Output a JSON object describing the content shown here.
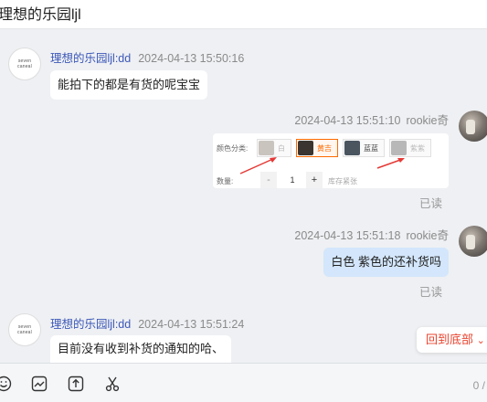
{
  "header": {
    "title": "理想的乐园ljl"
  },
  "messages": [
    {
      "name": "理想的乐园ljl:dd",
      "time": "2024-04-13 15:50:16",
      "text": "能拍下的都是有货的呢宝宝"
    },
    {
      "time": "2024-04-13 15:51:10",
      "name": "rookie奇",
      "status": "已读",
      "card": {
        "color_label": "颜色分类:",
        "options": [
          "白",
          "黄吉",
          "蓝蓝",
          "紫紫"
        ],
        "qty_label": "数量:",
        "qty_minus": "-",
        "qty_value": "1",
        "qty_plus": "+",
        "stock": "库存紧张"
      }
    },
    {
      "time": "2024-04-13 15:51:18",
      "name": "rookie奇",
      "text": "白色 紫色的还补货吗",
      "status": "已读"
    },
    {
      "name": "理想的乐园ljl:dd",
      "time": "2024-04-13 15:51:24",
      "text": "目前没有收到补货的通知的哈、"
    }
  ],
  "avatar_text": [
    "seven",
    "caneal"
  ],
  "back_to_bottom": "回到底部",
  "toolbar": {
    "icons": [
      "emoji-icon",
      "image-icon",
      "upload-icon",
      "scissors-icon"
    ],
    "char_count": "0 /"
  },
  "colors": {
    "accent_red": "#e8442f",
    "name_blue": "#3d58b8",
    "bubble_blue": "#d3e6fb"
  }
}
